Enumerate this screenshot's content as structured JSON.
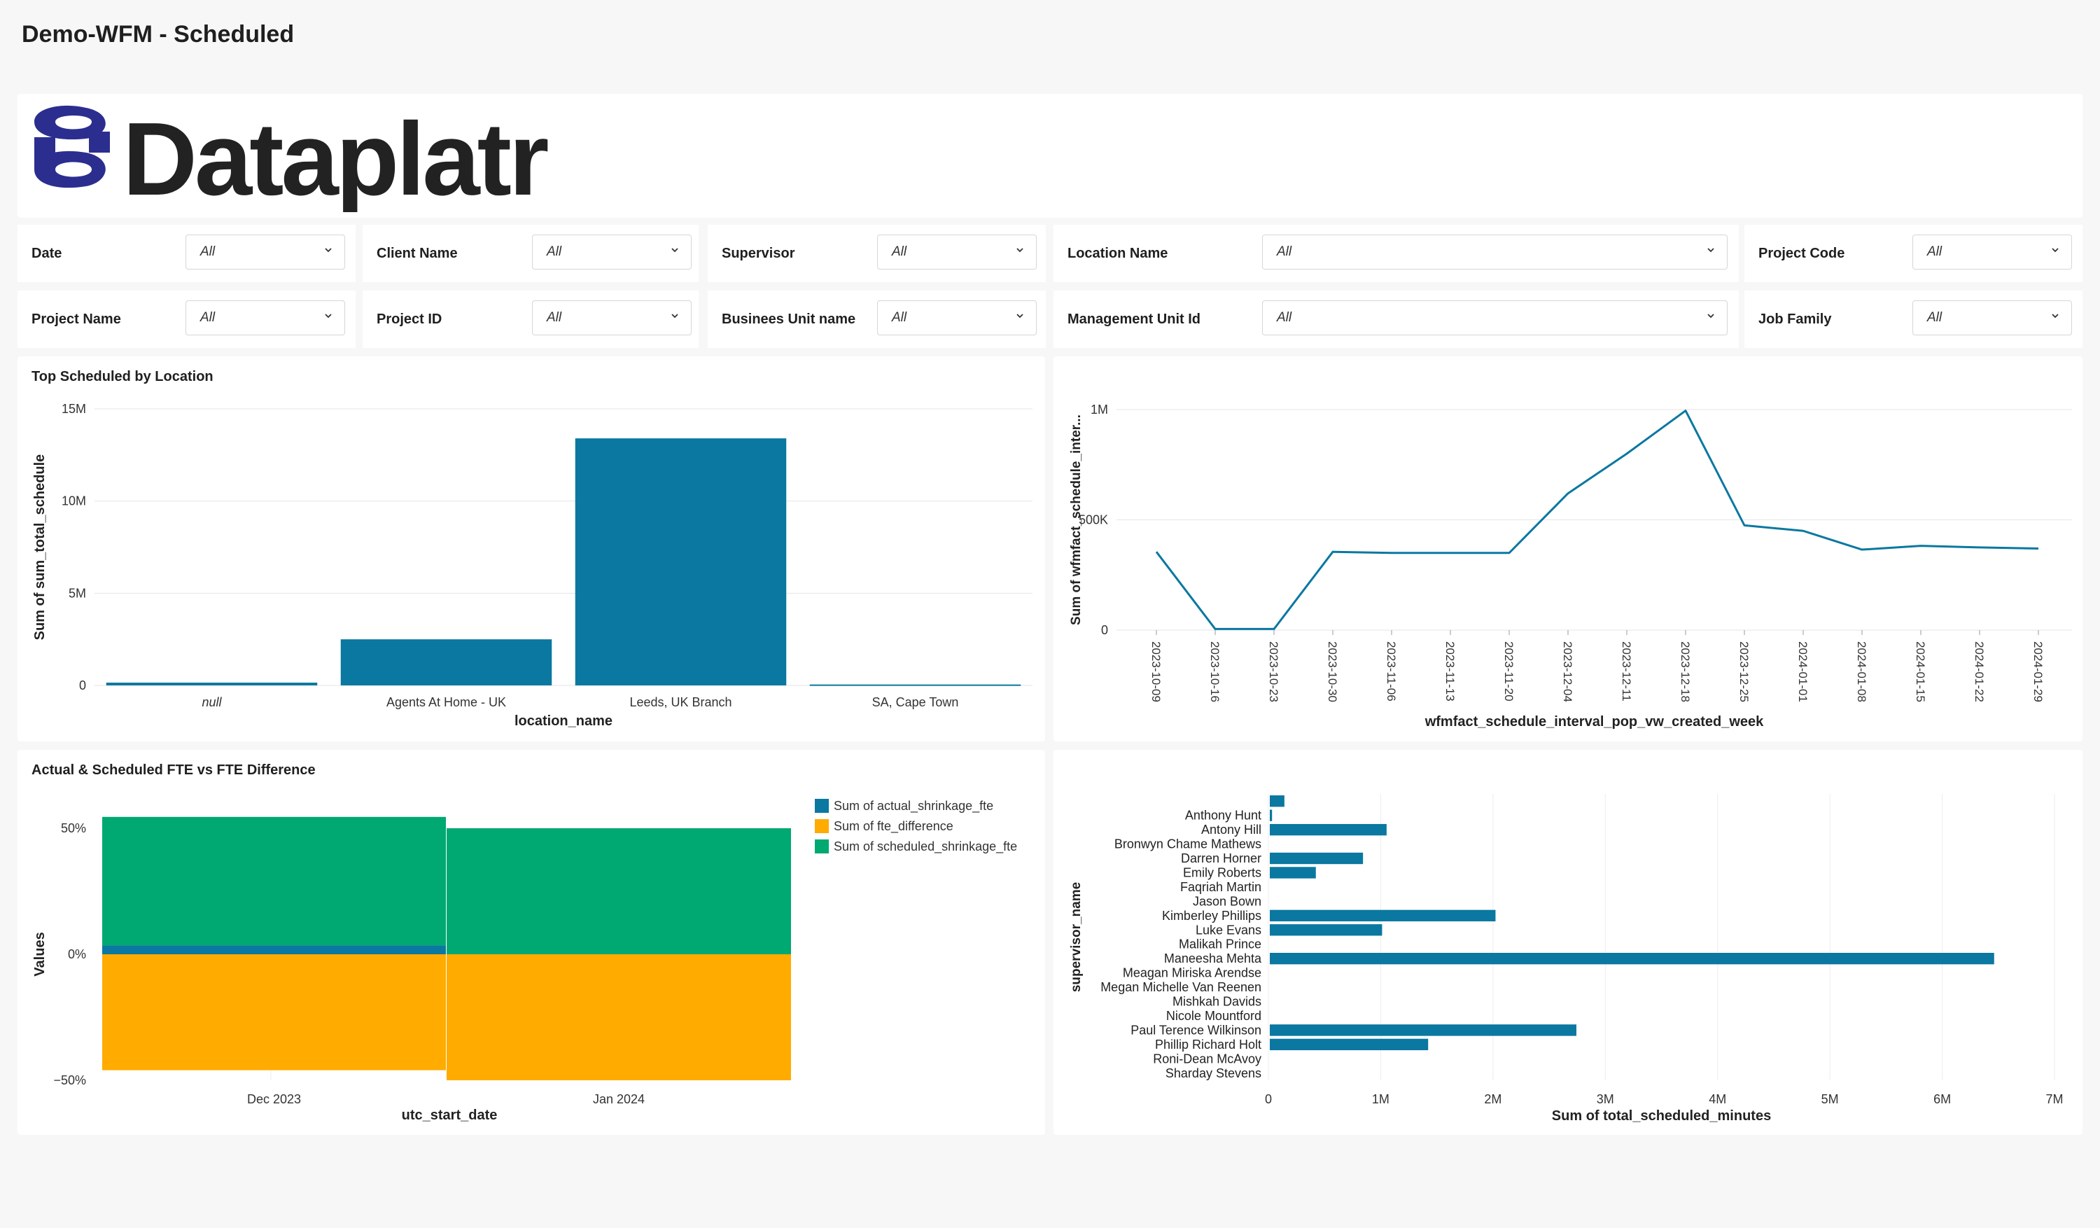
{
  "page": {
    "title": "Demo-WFM - Scheduled"
  },
  "logo": {
    "text": "Dataplatr",
    "color": "#2b2e8f"
  },
  "filters": [
    {
      "label": "Date",
      "value": "All"
    },
    {
      "label": "Client Name",
      "value": "All"
    },
    {
      "label": "Supervisor",
      "value": "All"
    },
    {
      "label": "Location Name",
      "value": "All"
    },
    {
      "label": "Project Code",
      "value": "All"
    },
    {
      "label": "Project Name",
      "value": "All"
    },
    {
      "label": "Project ID",
      "value": "All"
    },
    {
      "label": "Businees Unit name",
      "value": "All"
    },
    {
      "label": "Management Unit Id",
      "value": "All"
    },
    {
      "label": "Job Family",
      "value": "All"
    }
  ],
  "colors": {
    "blue": "#0a78a0",
    "orange": "#ffab00",
    "green": "#00a872"
  },
  "chart_data": [
    {
      "type": "bar",
      "title": "Top Scheduled by Location",
      "xlabel": "location_name",
      "ylabel": "Sum of sum_total_schedule",
      "categories": [
        "null",
        "Agents At Home - UK",
        "Leeds, UK Branch",
        "SA, Cape Town"
      ],
      "values": [
        150000,
        2500000,
        13400000,
        50000
      ],
      "ylim": [
        0,
        15000000
      ],
      "yticks": [
        {
          "v": 0,
          "label": "0"
        },
        {
          "v": 5000000,
          "label": "5M"
        },
        {
          "v": 10000000,
          "label": "10M"
        },
        {
          "v": 15000000,
          "label": "15M"
        }
      ],
      "grid": true
    },
    {
      "type": "line",
      "title": "",
      "xlabel": "wfmfact_schedule_interval_pop_vw_created_week",
      "ylabel": "Sum of wfmfact_schedule_inter...",
      "x": [
        "2023-10-09",
        "2023-10-16",
        "2023-10-23",
        "2023-10-30",
        "2023-11-06",
        "2023-11-13",
        "2023-11-20",
        "2023-12-04",
        "2023-12-11",
        "2023-12-18",
        "2023-12-25",
        "2024-01-01",
        "2024-01-08",
        "2024-01-15",
        "2024-01-22",
        "2024-01-29"
      ],
      "values": [
        355000,
        5000,
        5000,
        355000,
        350000,
        350000,
        350000,
        620000,
        800000,
        995000,
        475000,
        450000,
        365000,
        382000,
        375000,
        370000
      ],
      "ylim": [
        0,
        1000000
      ],
      "yticks": [
        {
          "v": 0,
          "label": "0"
        },
        {
          "v": 500000,
          "label": "500K"
        },
        {
          "v": 1000000,
          "label": "1M"
        }
      ],
      "grid": true
    },
    {
      "type": "bar",
      "stacked": true,
      "title": "Actual & Scheduled FTE vs FTE Difference",
      "xlabel": "utc_start_date",
      "ylabel": "Values",
      "categories": [
        "Dec 2023",
        "Jan 2024"
      ],
      "series": [
        {
          "name": "Sum of actual_shrinkage_fte",
          "values": [
            3.5,
            0
          ]
        },
        {
          "name": "Sum of fte_difference",
          "values": [
            -46,
            -50
          ]
        },
        {
          "name": "Sum of scheduled_shrinkage_fte",
          "values": [
            51,
            50
          ]
        }
      ],
      "ylim": [
        -50,
        50
      ],
      "yticks": [
        {
          "v": -50,
          "label": "−50%"
        },
        {
          "v": 0,
          "label": "0%"
        },
        {
          "v": 50,
          "label": "50%"
        }
      ],
      "legend": "top-right",
      "grid": true
    },
    {
      "type": "bar",
      "orientation": "horizontal",
      "title": "",
      "xlabel": "Sum of total_scheduled_minutes",
      "ylabel": "supervisor_name",
      "categories": [
        "",
        "Anthony  Hunt",
        "Antony  Hill",
        "Bronwyn Chame Mathews",
        "Darren  Horner",
        "Emily  Roberts",
        "Faqriah  Martin",
        "Jason  Bown",
        "Kimberley  Phillips",
        "Luke  Evans",
        "Malikah  Prince",
        "Maneesha  Mehta",
        "Meagan Miriska Arendse",
        "Megan Michelle Van Reenen",
        "Mishkah  Davids",
        "Nicole  Mountford",
        "Paul Terence Wilkinson",
        "Phillip Richard Holt",
        "Roni-Dean  McAvoy",
        "Sharday  Stevens"
      ],
      "values": [
        130000,
        20000,
        1040000,
        0,
        830000,
        410000,
        0,
        0,
        2010000,
        1000000,
        0,
        6450000,
        0,
        0,
        0,
        0,
        2730000,
        1410000,
        0,
        0
      ],
      "xlim": [
        0,
        7000000
      ],
      "xticks": [
        {
          "v": 0,
          "label": "0"
        },
        {
          "v": 1000000,
          "label": "1M"
        },
        {
          "v": 2000000,
          "label": "2M"
        },
        {
          "v": 3000000,
          "label": "3M"
        },
        {
          "v": 4000000,
          "label": "4M"
        },
        {
          "v": 5000000,
          "label": "5M"
        },
        {
          "v": 6000000,
          "label": "6M"
        },
        {
          "v": 7000000,
          "label": "7M"
        }
      ],
      "grid": true
    }
  ]
}
